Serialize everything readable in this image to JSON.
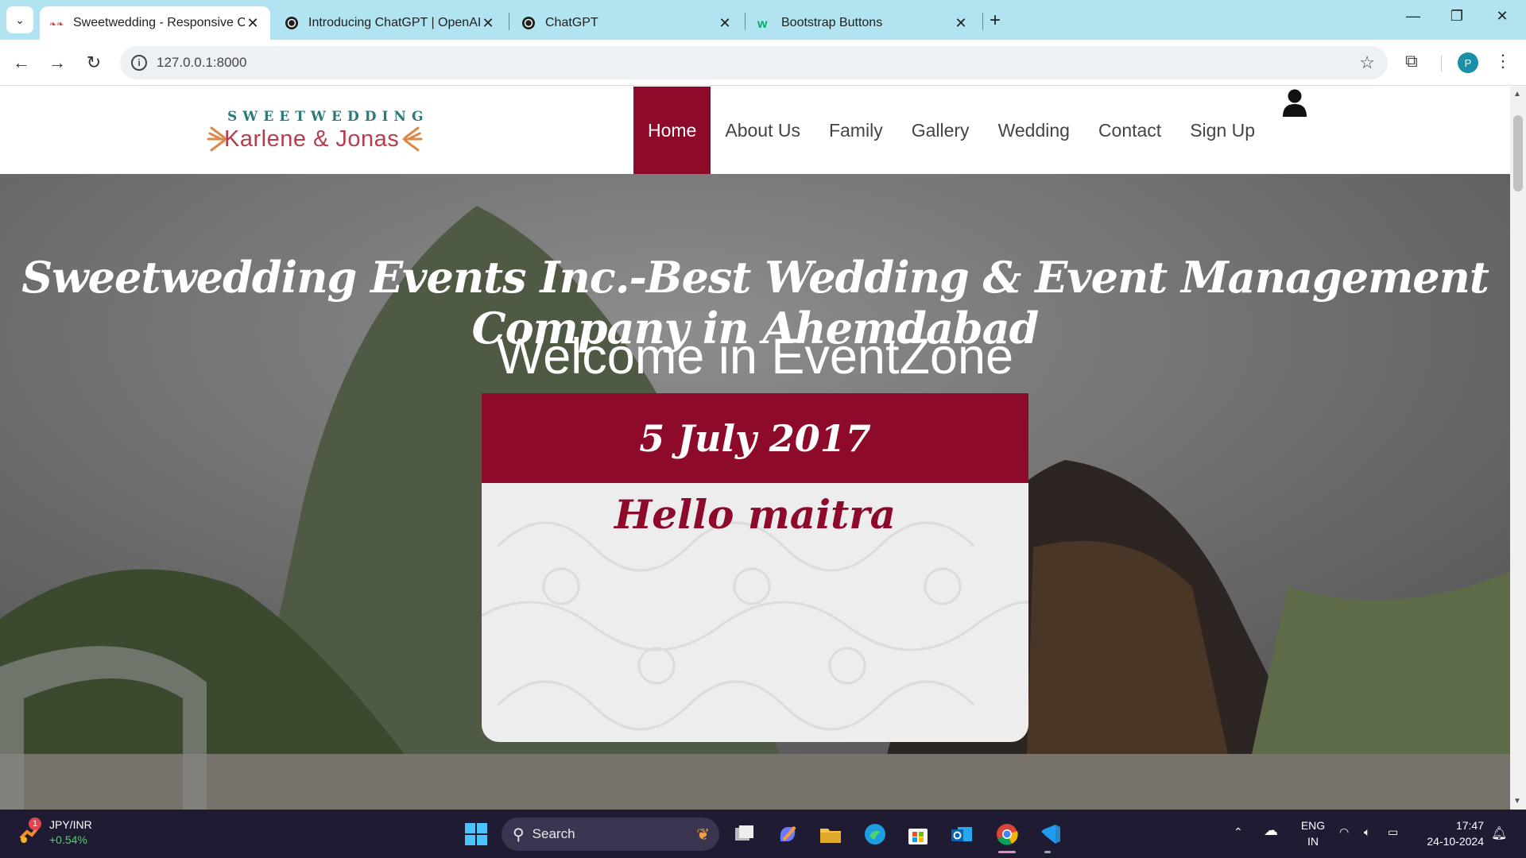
{
  "browser": {
    "tabs": [
      {
        "title": "Sweetwedding - Responsive On",
        "active": true
      },
      {
        "title": "Introducing ChatGPT | OpenAI",
        "active": false
      },
      {
        "title": "ChatGPT",
        "active": false
      },
      {
        "title": "Bootstrap Buttons",
        "active": false
      }
    ],
    "url": "127.0.0.1:8000",
    "profile_initial": "P"
  },
  "site": {
    "logo": {
      "top_line": "SWEETWEDDING",
      "names": "Karlene & Jonas"
    },
    "nav": [
      "Home",
      "About Us",
      "Family",
      "Gallery",
      "Wedding",
      "Contact",
      "Sign Up"
    ],
    "active_nav": "Home",
    "hero": {
      "title": "Sweetwedding Events Inc.-Best Wedding & Event Management Company in Ahemdabad",
      "subtitle": "Welcome in EventZone"
    },
    "card": {
      "date": "5 July 2017",
      "message": "Hello maitra"
    }
  },
  "taskbar": {
    "widget": {
      "label": "JPY/INR",
      "change": "+0.54%",
      "badge": "1"
    },
    "search_placeholder": "Search",
    "lang": {
      "line1": "ENG",
      "line2": "IN"
    },
    "time": "17:47",
    "date": "24-10-2024"
  },
  "colors": {
    "brand": "#8e0a2a",
    "tabbar": "#b2e3f0",
    "taskbar": "#1f1b33"
  }
}
